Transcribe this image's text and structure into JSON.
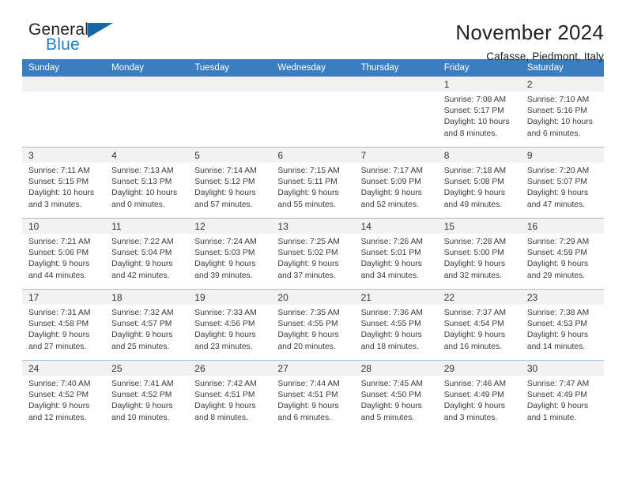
{
  "brand": {
    "name_part1": "General",
    "name_part2": "Blue",
    "flag_icon": "triangle-flag-icon"
  },
  "header": {
    "title": "November 2024",
    "subtitle": "Cafasse, Piedmont, Italy"
  },
  "colors": {
    "header_bar": "#3a7ebf",
    "brand_blue": "#1f7fc4",
    "daynum_band": "#f2f2f2",
    "grid_line": "#9fbfdd"
  },
  "weekday_headers": [
    "Sunday",
    "Monday",
    "Tuesday",
    "Wednesday",
    "Thursday",
    "Friday",
    "Saturday"
  ],
  "weeks": [
    [
      {
        "day": "",
        "sunrise": "",
        "sunset": "",
        "daylight1": "",
        "daylight2": ""
      },
      {
        "day": "",
        "sunrise": "",
        "sunset": "",
        "daylight1": "",
        "daylight2": ""
      },
      {
        "day": "",
        "sunrise": "",
        "sunset": "",
        "daylight1": "",
        "daylight2": ""
      },
      {
        "day": "",
        "sunrise": "",
        "sunset": "",
        "daylight1": "",
        "daylight2": ""
      },
      {
        "day": "",
        "sunrise": "",
        "sunset": "",
        "daylight1": "",
        "daylight2": ""
      },
      {
        "day": "1",
        "sunrise": "Sunrise: 7:08 AM",
        "sunset": "Sunset: 5:17 PM",
        "daylight1": "Daylight: 10 hours",
        "daylight2": "and 8 minutes."
      },
      {
        "day": "2",
        "sunrise": "Sunrise: 7:10 AM",
        "sunset": "Sunset: 5:16 PM",
        "daylight1": "Daylight: 10 hours",
        "daylight2": "and 6 minutes."
      }
    ],
    [
      {
        "day": "3",
        "sunrise": "Sunrise: 7:11 AM",
        "sunset": "Sunset: 5:15 PM",
        "daylight1": "Daylight: 10 hours",
        "daylight2": "and 3 minutes."
      },
      {
        "day": "4",
        "sunrise": "Sunrise: 7:13 AM",
        "sunset": "Sunset: 5:13 PM",
        "daylight1": "Daylight: 10 hours",
        "daylight2": "and 0 minutes."
      },
      {
        "day": "5",
        "sunrise": "Sunrise: 7:14 AM",
        "sunset": "Sunset: 5:12 PM",
        "daylight1": "Daylight: 9 hours",
        "daylight2": "and 57 minutes."
      },
      {
        "day": "6",
        "sunrise": "Sunrise: 7:15 AM",
        "sunset": "Sunset: 5:11 PM",
        "daylight1": "Daylight: 9 hours",
        "daylight2": "and 55 minutes."
      },
      {
        "day": "7",
        "sunrise": "Sunrise: 7:17 AM",
        "sunset": "Sunset: 5:09 PM",
        "daylight1": "Daylight: 9 hours",
        "daylight2": "and 52 minutes."
      },
      {
        "day": "8",
        "sunrise": "Sunrise: 7:18 AM",
        "sunset": "Sunset: 5:08 PM",
        "daylight1": "Daylight: 9 hours",
        "daylight2": "and 49 minutes."
      },
      {
        "day": "9",
        "sunrise": "Sunrise: 7:20 AM",
        "sunset": "Sunset: 5:07 PM",
        "daylight1": "Daylight: 9 hours",
        "daylight2": "and 47 minutes."
      }
    ],
    [
      {
        "day": "10",
        "sunrise": "Sunrise: 7:21 AM",
        "sunset": "Sunset: 5:06 PM",
        "daylight1": "Daylight: 9 hours",
        "daylight2": "and 44 minutes."
      },
      {
        "day": "11",
        "sunrise": "Sunrise: 7:22 AM",
        "sunset": "Sunset: 5:04 PM",
        "daylight1": "Daylight: 9 hours",
        "daylight2": "and 42 minutes."
      },
      {
        "day": "12",
        "sunrise": "Sunrise: 7:24 AM",
        "sunset": "Sunset: 5:03 PM",
        "daylight1": "Daylight: 9 hours",
        "daylight2": "and 39 minutes."
      },
      {
        "day": "13",
        "sunrise": "Sunrise: 7:25 AM",
        "sunset": "Sunset: 5:02 PM",
        "daylight1": "Daylight: 9 hours",
        "daylight2": "and 37 minutes."
      },
      {
        "day": "14",
        "sunrise": "Sunrise: 7:26 AM",
        "sunset": "Sunset: 5:01 PM",
        "daylight1": "Daylight: 9 hours",
        "daylight2": "and 34 minutes."
      },
      {
        "day": "15",
        "sunrise": "Sunrise: 7:28 AM",
        "sunset": "Sunset: 5:00 PM",
        "daylight1": "Daylight: 9 hours",
        "daylight2": "and 32 minutes."
      },
      {
        "day": "16",
        "sunrise": "Sunrise: 7:29 AM",
        "sunset": "Sunset: 4:59 PM",
        "daylight1": "Daylight: 9 hours",
        "daylight2": "and 29 minutes."
      }
    ],
    [
      {
        "day": "17",
        "sunrise": "Sunrise: 7:31 AM",
        "sunset": "Sunset: 4:58 PM",
        "daylight1": "Daylight: 9 hours",
        "daylight2": "and 27 minutes."
      },
      {
        "day": "18",
        "sunrise": "Sunrise: 7:32 AM",
        "sunset": "Sunset: 4:57 PM",
        "daylight1": "Daylight: 9 hours",
        "daylight2": "and 25 minutes."
      },
      {
        "day": "19",
        "sunrise": "Sunrise: 7:33 AM",
        "sunset": "Sunset: 4:56 PM",
        "daylight1": "Daylight: 9 hours",
        "daylight2": "and 23 minutes."
      },
      {
        "day": "20",
        "sunrise": "Sunrise: 7:35 AM",
        "sunset": "Sunset: 4:55 PM",
        "daylight1": "Daylight: 9 hours",
        "daylight2": "and 20 minutes."
      },
      {
        "day": "21",
        "sunrise": "Sunrise: 7:36 AM",
        "sunset": "Sunset: 4:55 PM",
        "daylight1": "Daylight: 9 hours",
        "daylight2": "and 18 minutes."
      },
      {
        "day": "22",
        "sunrise": "Sunrise: 7:37 AM",
        "sunset": "Sunset: 4:54 PM",
        "daylight1": "Daylight: 9 hours",
        "daylight2": "and 16 minutes."
      },
      {
        "day": "23",
        "sunrise": "Sunrise: 7:38 AM",
        "sunset": "Sunset: 4:53 PM",
        "daylight1": "Daylight: 9 hours",
        "daylight2": "and 14 minutes."
      }
    ],
    [
      {
        "day": "24",
        "sunrise": "Sunrise: 7:40 AM",
        "sunset": "Sunset: 4:52 PM",
        "daylight1": "Daylight: 9 hours",
        "daylight2": "and 12 minutes."
      },
      {
        "day": "25",
        "sunrise": "Sunrise: 7:41 AM",
        "sunset": "Sunset: 4:52 PM",
        "daylight1": "Daylight: 9 hours",
        "daylight2": "and 10 minutes."
      },
      {
        "day": "26",
        "sunrise": "Sunrise: 7:42 AM",
        "sunset": "Sunset: 4:51 PM",
        "daylight1": "Daylight: 9 hours",
        "daylight2": "and 8 minutes."
      },
      {
        "day": "27",
        "sunrise": "Sunrise: 7:44 AM",
        "sunset": "Sunset: 4:51 PM",
        "daylight1": "Daylight: 9 hours",
        "daylight2": "and 6 minutes."
      },
      {
        "day": "28",
        "sunrise": "Sunrise: 7:45 AM",
        "sunset": "Sunset: 4:50 PM",
        "daylight1": "Daylight: 9 hours",
        "daylight2": "and 5 minutes."
      },
      {
        "day": "29",
        "sunrise": "Sunrise: 7:46 AM",
        "sunset": "Sunset: 4:49 PM",
        "daylight1": "Daylight: 9 hours",
        "daylight2": "and 3 minutes."
      },
      {
        "day": "30",
        "sunrise": "Sunrise: 7:47 AM",
        "sunset": "Sunset: 4:49 PM",
        "daylight1": "Daylight: 9 hours",
        "daylight2": "and 1 minute."
      }
    ]
  ]
}
